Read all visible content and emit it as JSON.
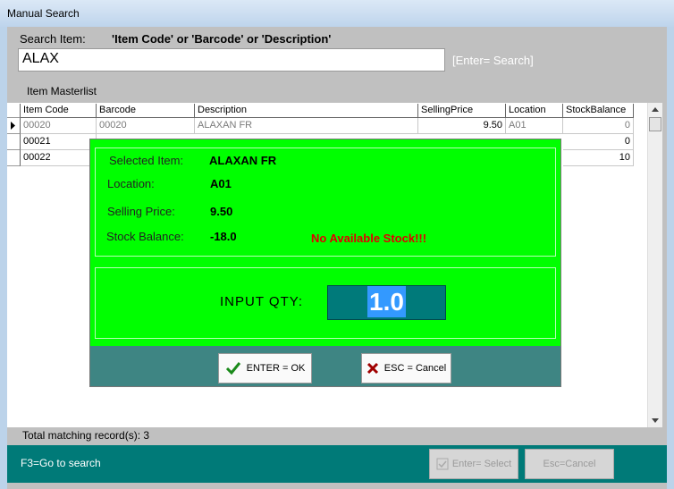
{
  "window": {
    "title": "Manual Search"
  },
  "search": {
    "label": "Search Item:",
    "criteria": "'Item Code' or 'Barcode' or 'Description'",
    "value": "ALAX",
    "hint": "[Enter= Search]"
  },
  "masterlist": {
    "label": "Item Masterlist",
    "columns": [
      "Item Code",
      "Barcode",
      "Description",
      "SellingPrice",
      "Location",
      "StockBalance"
    ],
    "rows": [
      {
        "code": "00020",
        "barcode": "00020",
        "description": "ALAXAN FR",
        "price": "9.50",
        "location": "A01",
        "stock": "0"
      },
      {
        "code": "00021",
        "barcode": "",
        "description": "",
        "price": "",
        "location": "",
        "stock": "0"
      },
      {
        "code": "00022",
        "barcode": "",
        "description": "",
        "price": "",
        "location": "",
        "stock": "10"
      }
    ]
  },
  "popup": {
    "selected_item_label": "Selected Item:",
    "selected_item_value": "ALAXAN FR",
    "location_label": "Location:",
    "location_value": "A01",
    "price_label": "Selling Price:",
    "price_value": "9.50",
    "stock_label": "Stock Balance:",
    "stock_value": "-18.0",
    "warning": "No Available Stock!!!",
    "qty_label": "INPUT QTY:",
    "qty_value": "1.0",
    "ok_label": "ENTER = OK",
    "cancel_label": "ESC = Cancel"
  },
  "status": {
    "total_matching": "Total matching record(s): 3"
  },
  "footer": {
    "hint": "F3=Go to search",
    "select_label": "Enter= Select",
    "cancel_label": "Esc=Cancel"
  },
  "colors": {
    "popup_bg": "#00ff00",
    "footer_bg": "#007a78",
    "warning": "#e00000",
    "button_bar": "#3e8583"
  },
  "icons": [
    "checkmark-icon",
    "x-icon",
    "row-pointer-icon",
    "scroll-up-icon",
    "scroll-down-icon"
  ]
}
